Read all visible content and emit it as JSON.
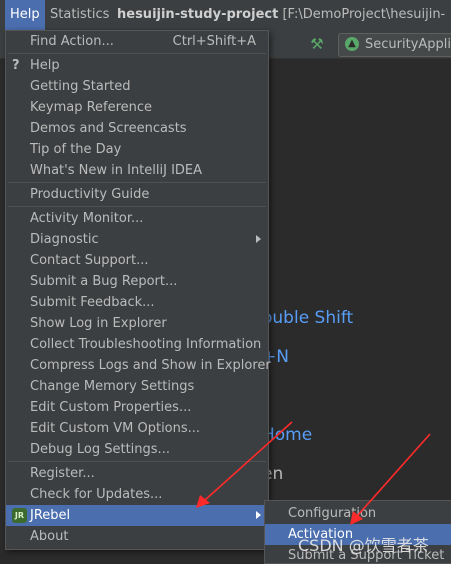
{
  "menubar": {
    "help_label": "Help",
    "statistics_label": "Statistics",
    "project_name": "hesuijin-study-project",
    "project_path": "[F:\\DemoProject\\hesuijin-study-pr"
  },
  "toolbar": {
    "run_config_label": "SecurityApplica"
  },
  "editor": {
    "hint_double_shift": "ouble Shift",
    "hint_n": "+N",
    "hint_home": "Home",
    "hint_en": "en"
  },
  "help_menu": {
    "find_action": {
      "label": "Find Action...",
      "shortcut": "Ctrl+Shift+A"
    },
    "items": [
      {
        "label": "Help"
      },
      {
        "label": "Getting Started"
      },
      {
        "label": "Keymap Reference"
      },
      {
        "label": "Demos and Screencasts"
      },
      {
        "label": "Tip of the Day"
      },
      {
        "label": "What's New in IntelliJ IDEA"
      },
      {
        "label": "Productivity Guide"
      },
      {
        "label": "Activity Monitor..."
      },
      {
        "label": "Diagnostic"
      },
      {
        "label": "Contact Support..."
      },
      {
        "label": "Submit a Bug Report..."
      },
      {
        "label": "Submit Feedback..."
      },
      {
        "label": "Show Log in Explorer"
      },
      {
        "label": "Collect Troubleshooting Information"
      },
      {
        "label": "Compress Logs and Show in Explorer"
      },
      {
        "label": "Change Memory Settings"
      },
      {
        "label": "Edit Custom Properties..."
      },
      {
        "label": "Edit Custom VM Options..."
      },
      {
        "label": "Debug Log Settings..."
      },
      {
        "label": "Register..."
      },
      {
        "label": "Check for Updates..."
      },
      {
        "label": "JRebel"
      },
      {
        "label": "About"
      }
    ]
  },
  "jrebel_submenu": {
    "items": [
      {
        "label": "Configuration"
      },
      {
        "label": "Activation"
      },
      {
        "label": "Submit a Support Ticket"
      }
    ]
  },
  "icons": {
    "help": "?",
    "jrebel": "JR",
    "hammer": "hammer-icon",
    "run_config": "spring-boot-icon"
  },
  "colors": {
    "highlight": "#4b6eaf",
    "menu_bg": "#3c3f41",
    "editor_bg": "#2b2b2b",
    "link_blue": "#589df6",
    "arrow_red": "#ff2a2a"
  },
  "watermark": "CSDN @饮雪者茶"
}
